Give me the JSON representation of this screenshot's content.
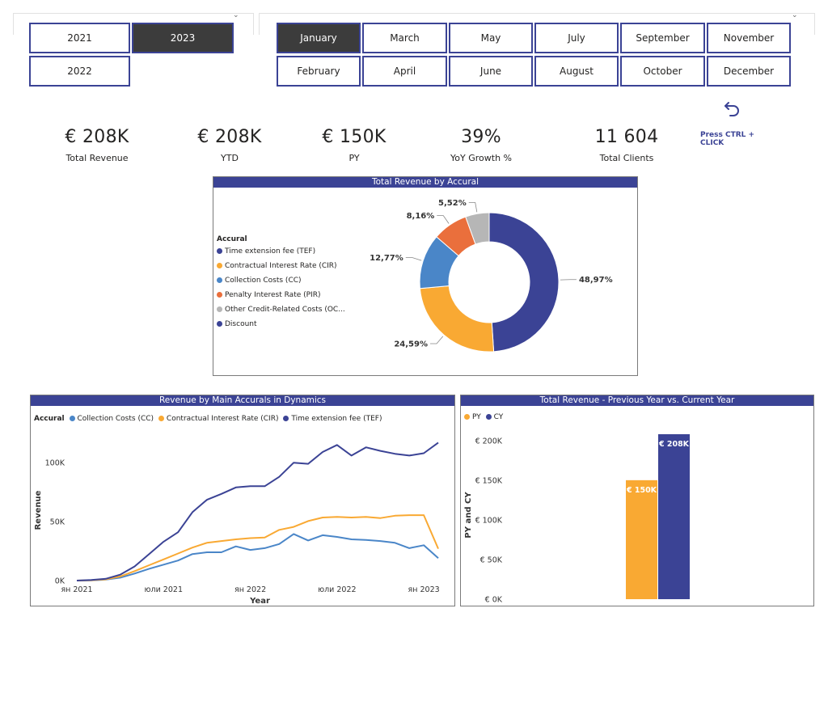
{
  "year_slicer": {
    "items": [
      {
        "label": "2021",
        "selected": false
      },
      {
        "label": "2023",
        "selected": true
      },
      {
        "label": "2022",
        "selected": false
      }
    ]
  },
  "month_slicer": {
    "items": [
      {
        "label": "January",
        "selected": true
      },
      {
        "label": "March",
        "selected": false
      },
      {
        "label": "May",
        "selected": false
      },
      {
        "label": "July",
        "selected": false
      },
      {
        "label": "September",
        "selected": false
      },
      {
        "label": "November",
        "selected": false
      },
      {
        "label": "February",
        "selected": false
      },
      {
        "label": "April",
        "selected": false
      },
      {
        "label": "June",
        "selected": false
      },
      {
        "label": "August",
        "selected": false
      },
      {
        "label": "October",
        "selected": false
      },
      {
        "label": "December",
        "selected": false
      }
    ]
  },
  "reset": {
    "hint": "Press CTRL + CLICK",
    "icon": "undo-arrow-icon"
  },
  "kpis": [
    {
      "value": "€ 208K",
      "label": "Total Revenue"
    },
    {
      "value": "€ 208K",
      "label": "YTD"
    },
    {
      "value": "€ 150K",
      "label": "PY"
    },
    {
      "value": "39%",
      "label": "YoY Growth %"
    },
    {
      "value": "11 604",
      "label": "Total Clients"
    }
  ],
  "colors": {
    "accent": "#3b4395",
    "navy": "#3b4395",
    "orange": "#f9a933",
    "blue": "#4a86c8",
    "red_orange": "#ea6f3c",
    "gray": "#b6b6b6"
  },
  "donut": {
    "title": "Total Revenue by Accural",
    "legend_title": "Accural",
    "legend": [
      {
        "name": "Time extension fee (TEF)",
        "color": "#3b4395"
      },
      {
        "name": "Contractual Interest Rate (CIR)",
        "color": "#f9a933"
      },
      {
        "name": "Collection Costs (CC)",
        "color": "#4a86c8"
      },
      {
        "name": "Penalty Interest Rate (PIR)",
        "color": "#ea6f3c"
      },
      {
        "name": "Other Credit-Related Costs (OC...",
        "color": "#b6b6b6"
      },
      {
        "name": "Discount",
        "color": "#3b4395"
      }
    ]
  },
  "line": {
    "title": "Revenue by Main Accurals in Dynamics",
    "legend_title": "Accural",
    "legend": [
      {
        "name": "Collection Costs (CC)",
        "color": "#4a86c8"
      },
      {
        "name": "Contractual Interest Rate (CIR)",
        "color": "#f9a933"
      },
      {
        "name": "Time extension fee (TEF)",
        "color": "#3b4395"
      }
    ]
  },
  "bar": {
    "title": "Total Revenue - Previous Year vs. Current Year",
    "legend": [
      {
        "name": "PY",
        "color": "#f9a933"
      },
      {
        "name": "CY",
        "color": "#3b4395"
      }
    ]
  },
  "chart_data": [
    {
      "type": "pie",
      "title": "Total Revenue by Accural",
      "categories": [
        "Time extension fee (TEF)",
        "Contractual Interest Rate (CIR)",
        "Collection Costs (CC)",
        "Penalty Interest Rate (PIR)",
        "Other Credit-Related Costs (OC...",
        "Discount"
      ],
      "values": [
        48.97,
        24.59,
        12.77,
        8.16,
        5.52,
        0
      ],
      "labels": [
        "48,97%",
        "24,59%",
        "12,77%",
        "8,16%",
        "5,52%",
        ""
      ],
      "colors": [
        "#3b4395",
        "#f9a933",
        "#4a86c8",
        "#ea6f3c",
        "#b6b6b6",
        "#3b4395"
      ],
      "donut": true,
      "legend_placement": "left"
    },
    {
      "type": "line",
      "title": "Revenue by Main Accurals in Dynamics",
      "xlabel": "Year",
      "ylabel": "Revenue",
      "x": [
        "2021-01",
        "2021-02",
        "2021-03",
        "2021-04",
        "2021-05",
        "2021-06",
        "2021-07",
        "2021-08",
        "2021-09",
        "2021-10",
        "2021-11",
        "2021-12",
        "2022-01",
        "2022-02",
        "2022-03",
        "2022-04",
        "2022-05",
        "2022-06",
        "2022-07",
        "2022-08",
        "2022-09",
        "2022-10",
        "2022-11",
        "2022-12",
        "2023-01",
        "2023-02"
      ],
      "xticks": [
        "ян 2021",
        "юли 2021",
        "ян 2022",
        "юли 2022",
        "ян 2023"
      ],
      "xtick_dates": [
        "2021-01",
        "2021-07",
        "2022-01",
        "2022-07",
        "2023-01"
      ],
      "yticks": [
        "0K",
        "50K",
        "100K"
      ],
      "ytick_values": [
        0,
        50000,
        100000
      ],
      "ylim": [
        0,
        120000
      ],
      "grid": false,
      "legend_placement": "top-left",
      "series": [
        {
          "name": "Collection Costs (CC)",
          "color": "#4a86c8",
          "values": [
            0,
            200,
            800,
            2500,
            6000,
            10000,
            13500,
            17000,
            22500,
            24000,
            24000,
            29000,
            26000,
            27500,
            31000,
            39500,
            34000,
            38500,
            37000,
            35000,
            34500,
            33500,
            32000,
            27500,
            30000,
            19000
          ]
        },
        {
          "name": "Contractual Interest Rate (CIR)",
          "color": "#f9a933",
          "values": [
            0,
            300,
            1000,
            3500,
            8000,
            13000,
            18000,
            23000,
            28000,
            32000,
            33500,
            35000,
            36000,
            36500,
            43000,
            45500,
            50500,
            53500,
            54000,
            53500,
            54000,
            53000,
            55000,
            55500,
            55500,
            27000
          ]
        },
        {
          "name": "Time extension fee (TEF)",
          "color": "#3b4395",
          "values": [
            0,
            500,
            1500,
            5000,
            12000,
            22500,
            33000,
            41000,
            58000,
            68500,
            73500,
            79000,
            80000,
            80000,
            88000,
            100000,
            99000,
            109000,
            115000,
            106000,
            113000,
            110000,
            107500,
            106000,
            108000,
            117000
          ]
        }
      ]
    },
    {
      "type": "bar",
      "title": "Total Revenue - Previous Year vs. Current Year",
      "ylabel": "PY and CY",
      "categories": [
        "PY",
        "CY"
      ],
      "values": [
        150000,
        208000
      ],
      "labels": [
        "€ 150K",
        "€ 208K"
      ],
      "colors": [
        "#f9a933",
        "#3b4395"
      ],
      "yticks": [
        "€ 0K",
        "€ 50K",
        "€ 100K",
        "€ 150K",
        "€ 200K"
      ],
      "ytick_values": [
        0,
        50000,
        100000,
        150000,
        200000
      ],
      "ylim": [
        0,
        210000
      ],
      "legend_placement": "top-left"
    }
  ]
}
